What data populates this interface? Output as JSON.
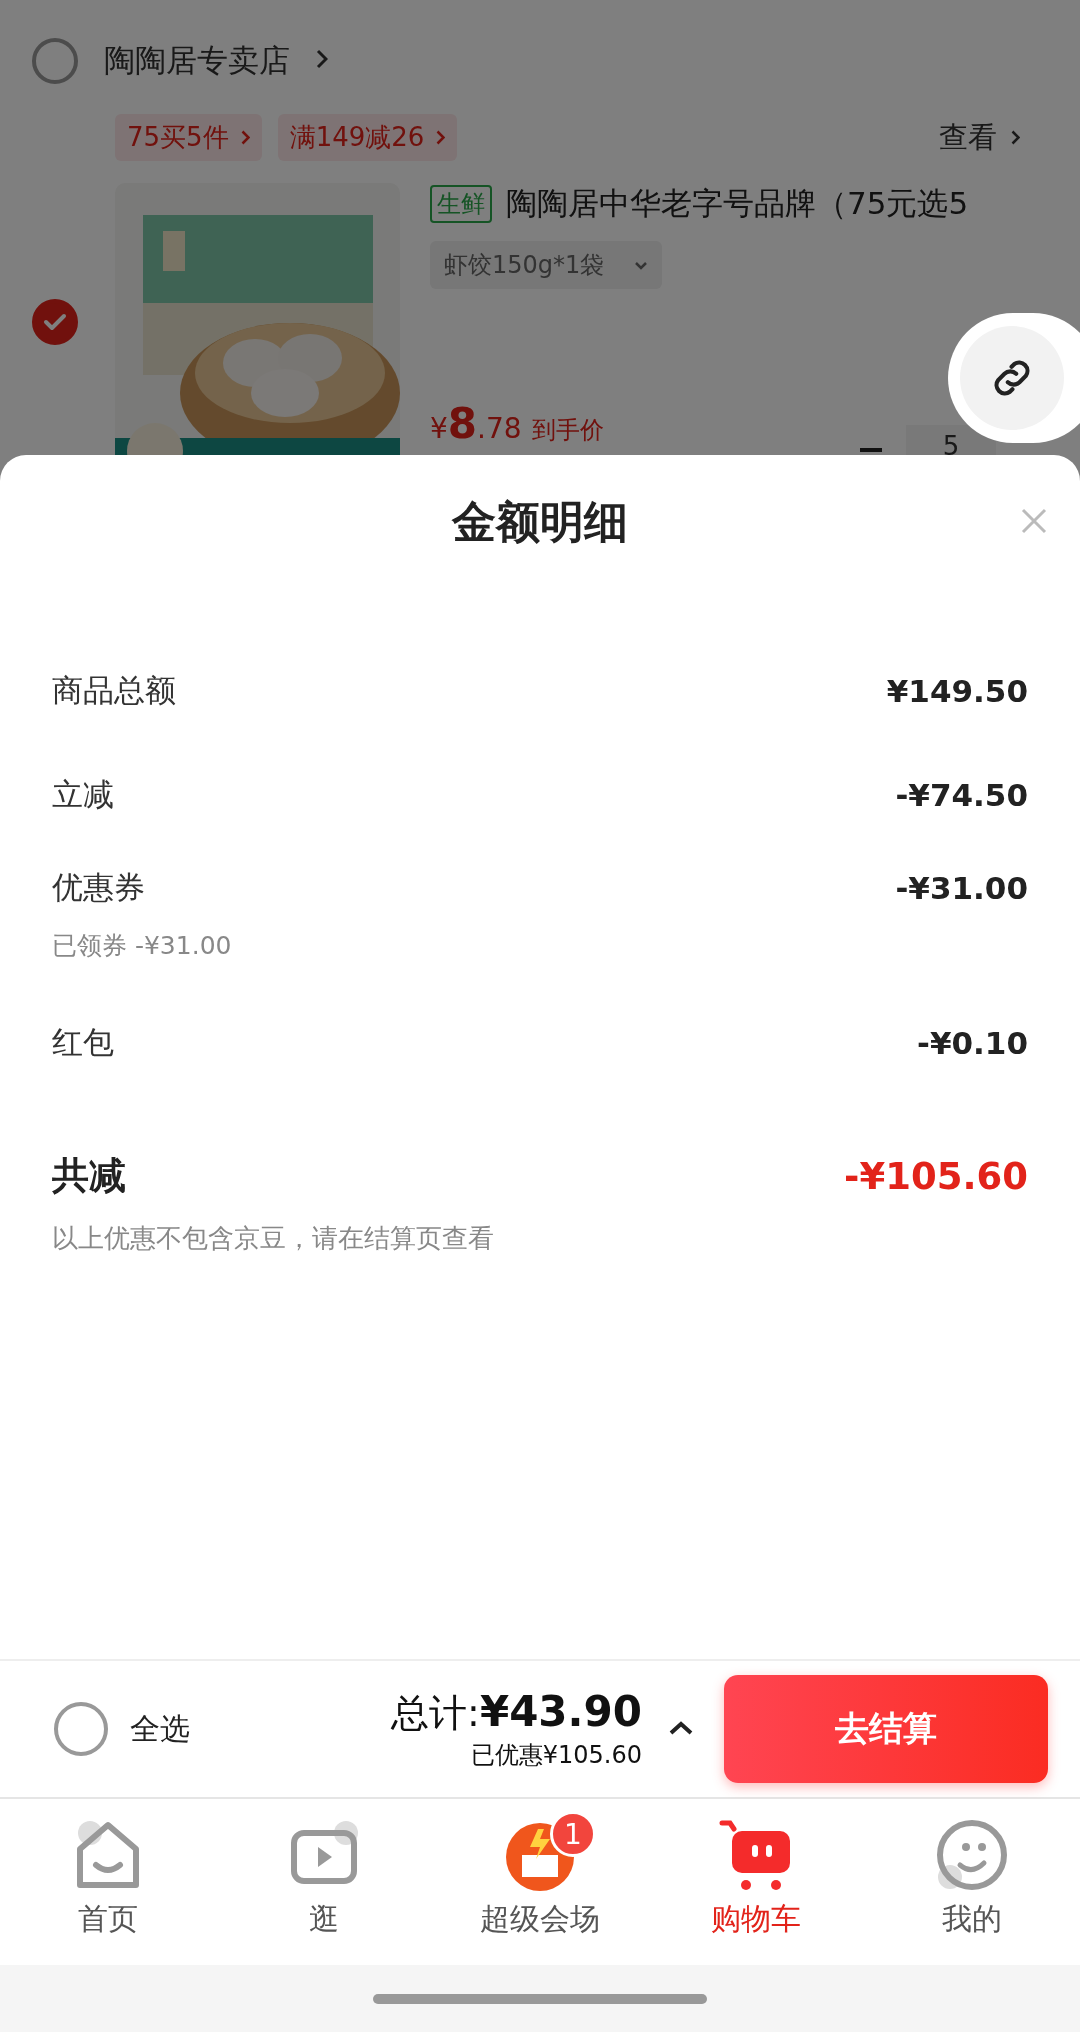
{
  "store": {
    "name": "陶陶居专卖店",
    "checked": false
  },
  "promo_tags": [
    "75买5件",
    "满149减26"
  ],
  "view_link": "查看",
  "product": {
    "checked": true,
    "tag": "生鲜",
    "title": "陶陶居中华老字号品牌（75元选5",
    "variant": "虾饺150g*1袋",
    "price": {
      "symbol": "¥",
      "integer": "8",
      "decimal": ".78"
    },
    "price_note": "到手价",
    "quantity": "5"
  },
  "sheet": {
    "title": "金额明细",
    "rows": [
      {
        "label": "商品总额",
        "value": "¥149.50"
      },
      {
        "label": "立减",
        "value": "-¥74.50"
      },
      {
        "label": "优惠券",
        "value": "-¥31.00",
        "note": "已领券 -¥31.00"
      },
      {
        "label": "红包",
        "value": "-¥0.10"
      }
    ],
    "total": {
      "label": "共减",
      "value": "-¥105.60"
    },
    "footnote": "以上优惠不包含京豆，请在结算页查看"
  },
  "bottom_bar": {
    "select_all": {
      "label": "全选",
      "checked": false
    },
    "total_label": "总计:",
    "total": "¥43.90",
    "saved": "已优惠¥105.60",
    "checkout": "去结算"
  },
  "tabs": [
    {
      "kind": "home",
      "label": "首页",
      "selected": false
    },
    {
      "kind": "video",
      "label": "逛",
      "selected": false
    },
    {
      "kind": "promo",
      "label": "超级会场",
      "selected": false,
      "badge": "1"
    },
    {
      "kind": "cart",
      "label": "购物车",
      "selected": true
    },
    {
      "kind": "profile",
      "label": "我的",
      "selected": false
    }
  ]
}
